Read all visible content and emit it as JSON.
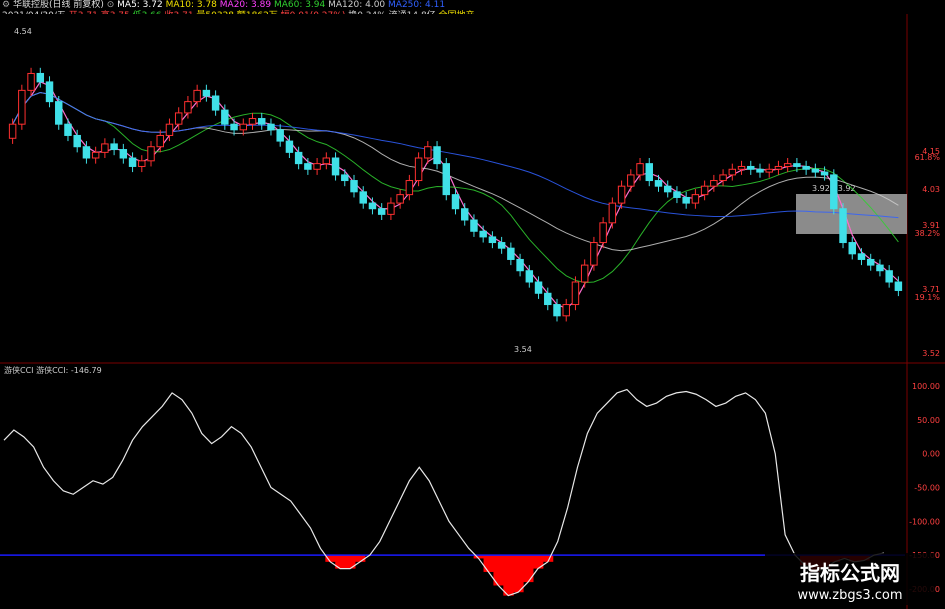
{
  "header": {
    "line1": {
      "stock_name": "华联控股(日线 前复权)",
      "ma_items": [
        {
          "label": "MA5: 3.72",
          "color": "#ffffff"
        },
        {
          "label": "MA10: 3.78",
          "color": "#f0e000"
        },
        {
          "label": "MA20: 3.89",
          "color": "#ff40ff"
        },
        {
          "label": "MA60: 3.94",
          "color": "#30d030"
        },
        {
          "label": "MA120: 4.00",
          "color": "#cccccc"
        },
        {
          "label": "MA250: 4.11",
          "color": "#3060ff"
        }
      ]
    },
    "line2": {
      "date": "2021/04/30/五",
      "items": [
        {
          "label": "开3.71",
          "color": "#ff4040"
        },
        {
          "label": "高3.75",
          "color": "#ff4040"
        },
        {
          "label": "低3.66",
          "color": "#30d030"
        },
        {
          "label": "收3.71",
          "color": "#ff4040"
        },
        {
          "label": "量50328",
          "color": "#f0e000"
        },
        {
          "label": "额1862万",
          "color": "#f0e000"
        },
        {
          "label": "幅0.01(0.27%)",
          "color": "#ff4040"
        },
        {
          "label": "换0.34%",
          "color": "#cccccc"
        },
        {
          "label": "流通14.8亿",
          "color": "#cccccc"
        },
        {
          "label": "全国地产",
          "color": "#f0e000"
        }
      ]
    }
  },
  "price_panel": {
    "high_marker": "4.54",
    "low_marker": "3.54",
    "box_label": "3.92 - 3.92",
    "right_labels": [
      {
        "text": "4.15",
        "color": "#ff4040"
      },
      {
        "text": "61.8%",
        "color": "#ff4040"
      },
      {
        "text": "4.03",
        "color": "#ff4040"
      },
      {
        "text": "3.91",
        "color": "#ff4040"
      },
      {
        "text": "38.2%",
        "color": "#ff4040"
      },
      {
        "text": "3.71",
        "color": "#ff4040"
      },
      {
        "text": "19.1%",
        "color": "#ff4040"
      },
      {
        "text": "3.52",
        "color": "#ff4040"
      }
    ]
  },
  "indicator": {
    "title": "游侠CCI",
    "value_label": "游侠CCI: -146.79",
    "line_color": "#e8e8e8",
    "fill_color": "#ff0000",
    "threshold_color": "#1a1aff"
  },
  "chart_data": [
    {
      "type": "candlestick",
      "title": "",
      "note_values": "close prices, approximate",
      "series": [
        {
          "name": "MA5",
          "color": "#ffffff"
        },
        {
          "name": "MA10",
          "color": "#f0e000"
        },
        {
          "name": "MA20",
          "color": "#ff40ff"
        },
        {
          "name": "MA60",
          "color": "#30d030"
        },
        {
          "name": "MA120",
          "color": "#cccccc"
        },
        {
          "name": "MA250",
          "color": "#3060ff"
        }
      ],
      "close": [
        4.3,
        4.42,
        4.48,
        4.45,
        4.38,
        4.3,
        4.26,
        4.22,
        4.18,
        4.2,
        4.23,
        4.21,
        4.18,
        4.15,
        4.17,
        4.22,
        4.26,
        4.3,
        4.34,
        4.38,
        4.42,
        4.4,
        4.35,
        4.3,
        4.28,
        4.3,
        4.32,
        4.3,
        4.28,
        4.24,
        4.2,
        4.16,
        4.14,
        4.16,
        4.18,
        4.12,
        4.1,
        4.06,
        4.02,
        4.0,
        3.98,
        4.02,
        4.05,
        4.1,
        4.18,
        4.22,
        4.16,
        4.05,
        4.0,
        3.96,
        3.92,
        3.9,
        3.88,
        3.86,
        3.82,
        3.78,
        3.74,
        3.7,
        3.66,
        3.62,
        3.66,
        3.74,
        3.8,
        3.88,
        3.95,
        4.02,
        4.08,
        4.12,
        4.16,
        4.1,
        4.08,
        4.06,
        4.04,
        4.02,
        4.05,
        4.08,
        4.1,
        4.12,
        4.14,
        4.15,
        4.14,
        4.13,
        4.14,
        4.15,
        4.16,
        4.15,
        4.14,
        4.13,
        4.12,
        4.0,
        3.88,
        3.84,
        3.82,
        3.8,
        3.78,
        3.74,
        3.71
      ],
      "ylim": [
        3.52,
        4.62
      ],
      "right_axis": [
        4.15,
        4.03,
        3.91,
        3.71,
        3.52
      ]
    },
    {
      "type": "line",
      "title": "游侠CCI",
      "y_ticks": [
        100,
        50,
        0,
        -50,
        -100,
        -150,
        -200
      ],
      "ylim": [
        -215,
        115
      ],
      "threshold": -150,
      "last_value": -146.79,
      "values": [
        20,
        35,
        25,
        10,
        -20,
        -40,
        -55,
        -60,
        -50,
        -40,
        -45,
        -35,
        -10,
        20,
        40,
        55,
        70,
        90,
        80,
        60,
        30,
        15,
        25,
        40,
        30,
        10,
        -20,
        -50,
        -60,
        -70,
        -90,
        -110,
        -140,
        -160,
        -170,
        -170,
        -160,
        -150,
        -130,
        -100,
        -70,
        -40,
        -20,
        -40,
        -70,
        -100,
        -120,
        -140,
        -155,
        -175,
        -195,
        -210,
        -205,
        -190,
        -170,
        -160,
        -130,
        -80,
        -20,
        30,
        60,
        75,
        90,
        95,
        80,
        70,
        75,
        85,
        90,
        92,
        88,
        80,
        70,
        75,
        85,
        90,
        80,
        60,
        0,
        -120,
        -150,
        -165,
        -175,
        -170,
        -160,
        -155,
        -160,
        -158,
        -150,
        -147
      ]
    }
  ]
}
